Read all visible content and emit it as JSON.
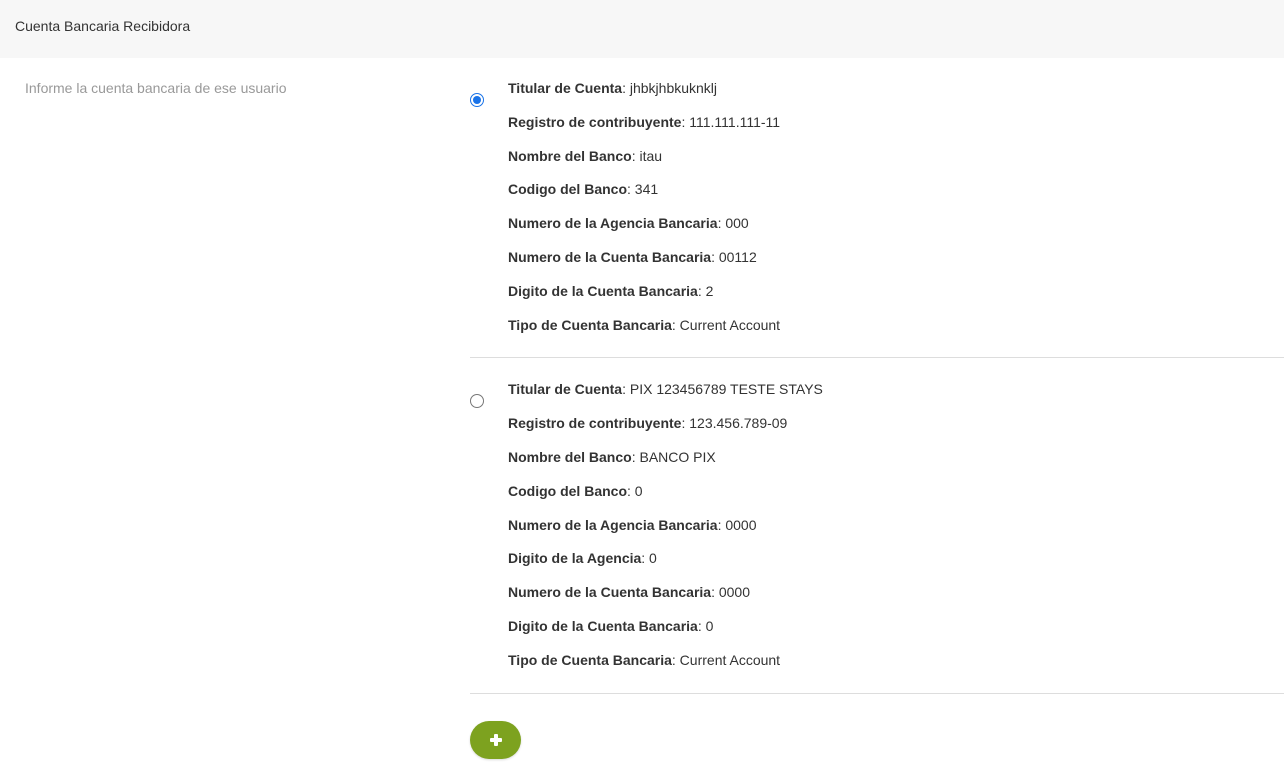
{
  "header": {
    "title": "Cuenta Bancaria Recibidora"
  },
  "description": "Informe la cuenta bancaria de ese usuario",
  "accounts": [
    {
      "selected": true,
      "fields": [
        {
          "label": "Titular de Cuenta",
          "value": ": jhbkjhbkuknklj"
        },
        {
          "label": "Registro de contribuyente",
          "value": ": 111.111.111-11"
        },
        {
          "label": "Nombre del Banco",
          "value": ": itau"
        },
        {
          "label": "Codigo del Banco",
          "value": ": 341"
        },
        {
          "label": "Numero de la Agencia Bancaria",
          "value": ": 000"
        },
        {
          "label": "Numero de la Cuenta Bancaria",
          "value": ": 00112"
        },
        {
          "label": "Digito de la Cuenta Bancaria",
          "value": ": 2"
        },
        {
          "label": "Tipo de Cuenta Bancaria",
          "value": ": Current Account"
        }
      ]
    },
    {
      "selected": false,
      "fields": [
        {
          "label": "Titular de Cuenta",
          "value": ": PIX 123456789 TESTE STAYS"
        },
        {
          "label": "Registro de contribuyente",
          "value": ": 123.456.789-09"
        },
        {
          "label": "Nombre del Banco",
          "value": ": BANCO PIX"
        },
        {
          "label": "Codigo del Banco",
          "value": ": 0"
        },
        {
          "label": "Numero de la Agencia Bancaria",
          "value": ": 0000"
        },
        {
          "label": "Digito de la Agencia",
          "value": ": 0"
        },
        {
          "label": "Numero de la Cuenta Bancaria",
          "value": ": 0000"
        },
        {
          "label": "Digito de la Cuenta Bancaria",
          "value": ": 0"
        },
        {
          "label": "Tipo de Cuenta Bancaria",
          "value": ": Current Account"
        }
      ]
    }
  ],
  "add_button": {
    "icon": "plus-icon",
    "color": "#7da21f"
  },
  "colors": {
    "radio_selected": "#1a73e8",
    "header_bg": "#f7f7f7"
  }
}
